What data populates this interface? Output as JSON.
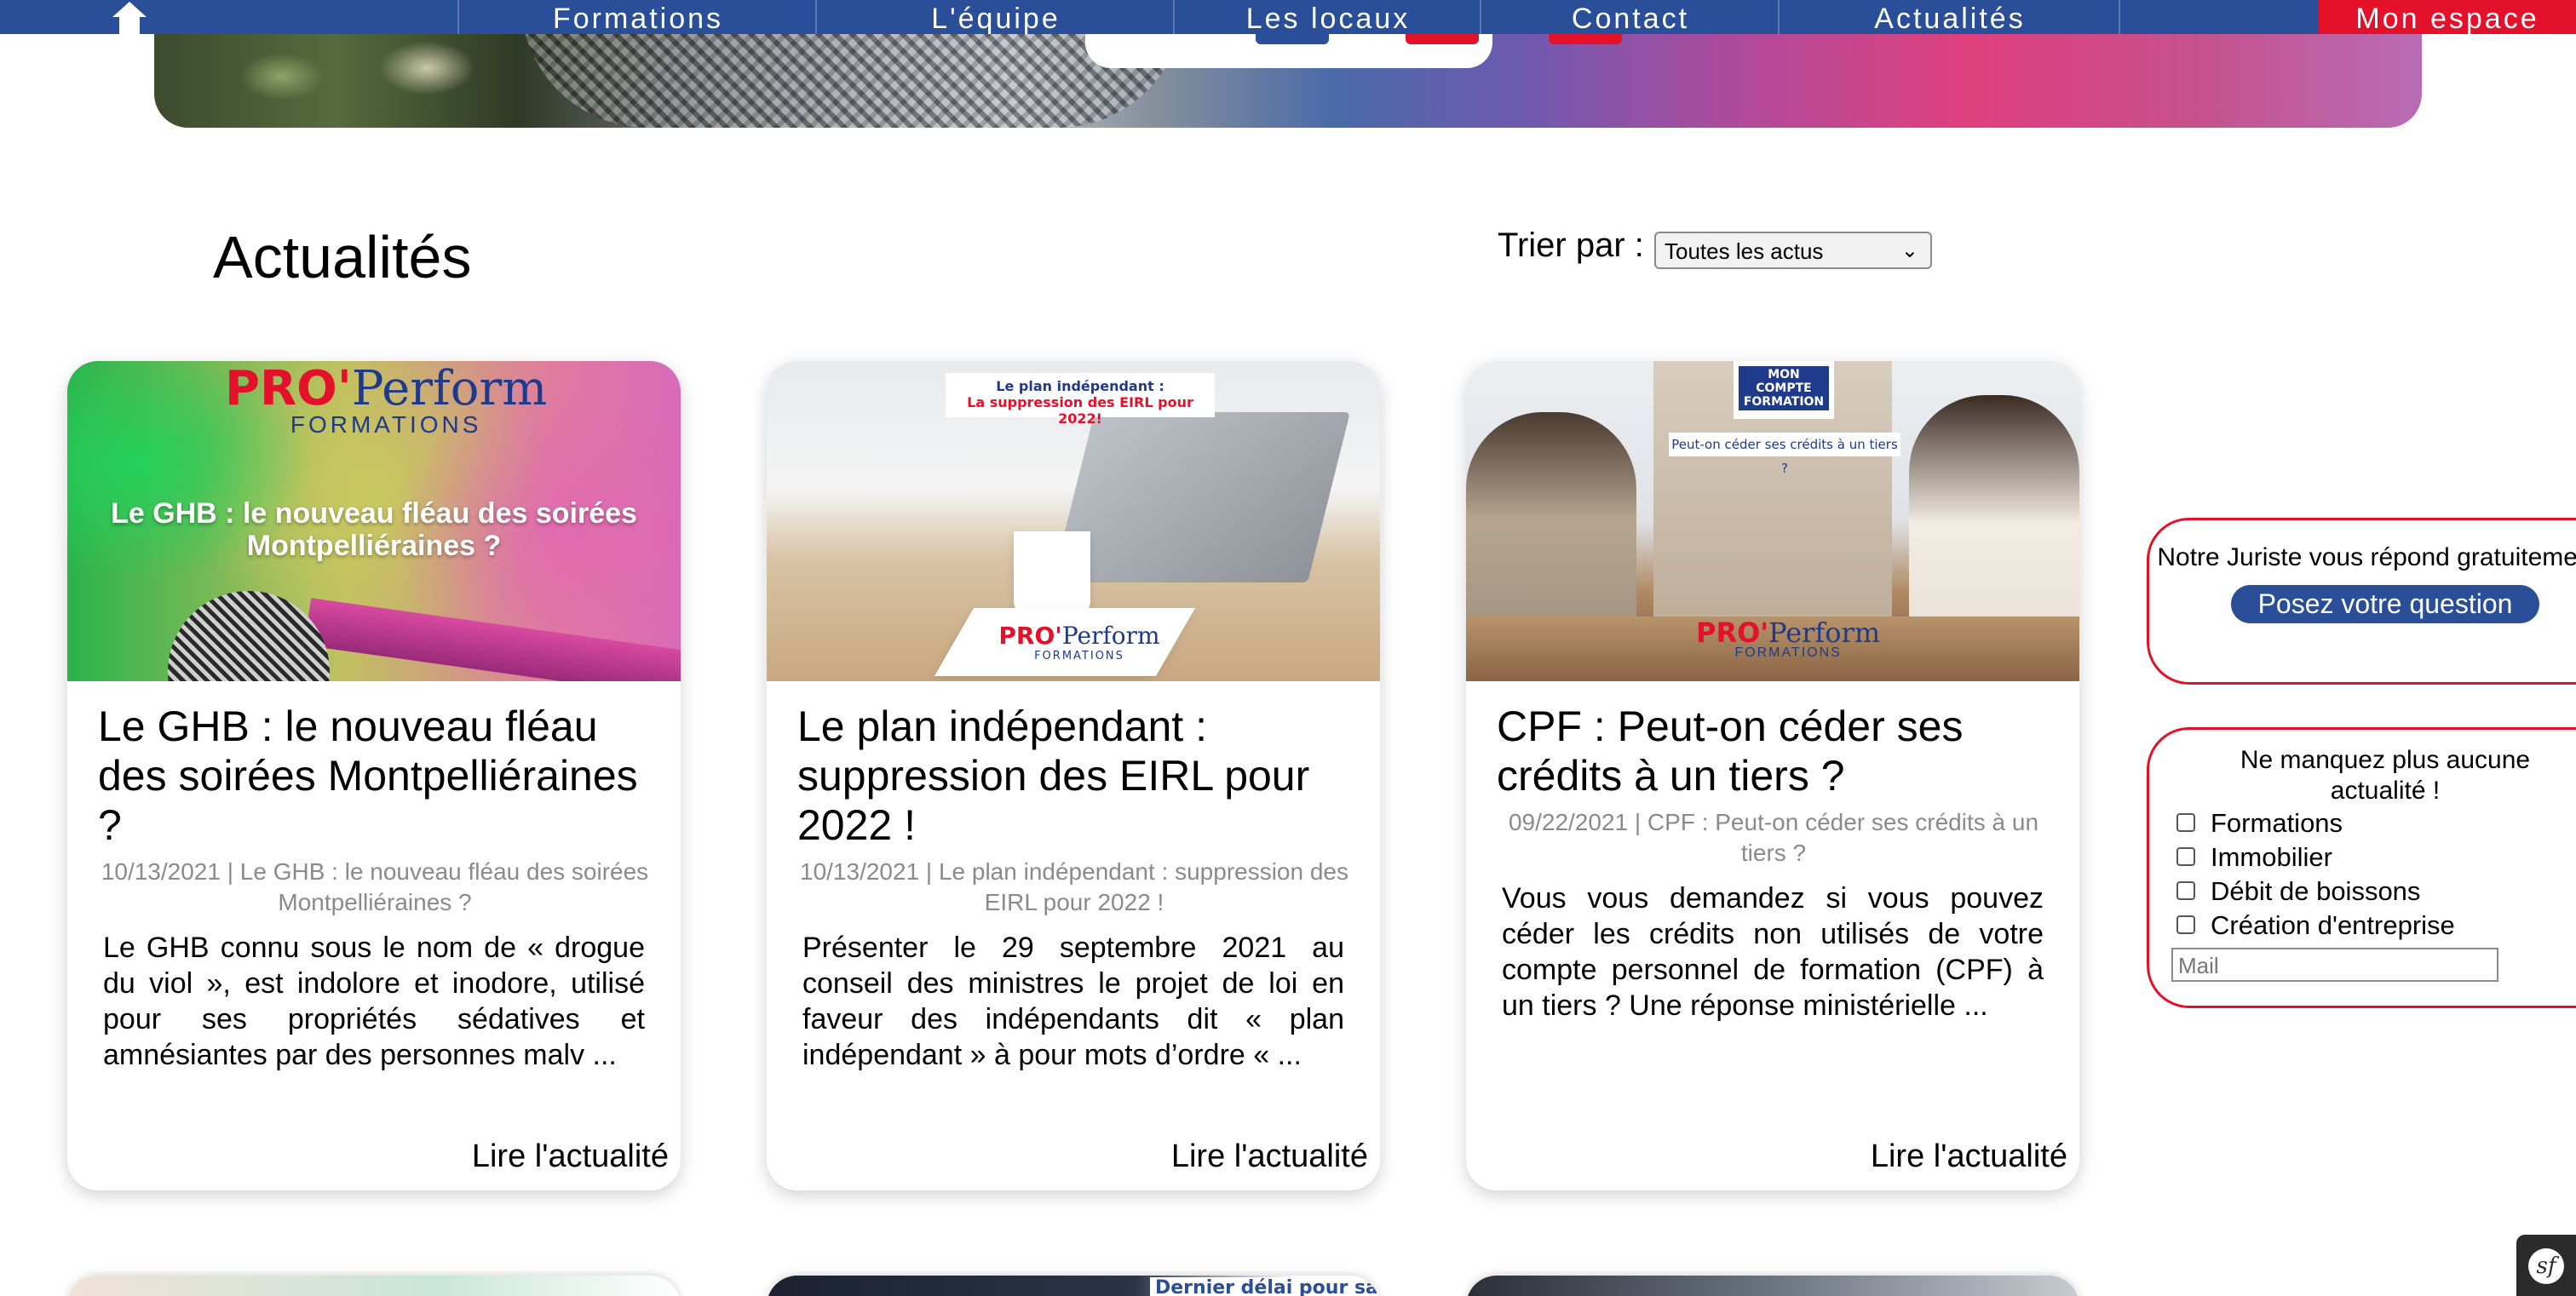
{
  "nav": {
    "items": [
      "Formations",
      "L'équipe",
      "Les locaux",
      "Contact",
      "Actualités"
    ],
    "espace": "Mon espace",
    "home_icon": "home-icon"
  },
  "page": {
    "title": "Actualités",
    "sort_label": "Trier par :",
    "sort_selected": "Toutes les actus"
  },
  "logo": {
    "pro": "PRO'",
    "perform": "Perform",
    "sub": "FORMATIONS"
  },
  "cards": [
    {
      "image_text": "Le GHB : le nouveau fléau des soirées Montpelliéraines ?",
      "title": "Le GHB : le nouveau fléau des soirées Montpelliéraines ?",
      "meta": "10/13/2021 | Le GHB : le nouveau fléau des soirées Montpelliéraines ?",
      "excerpt": "Le GHB connu sous le nom de « drogue du viol », est indolore et inodore, utilisé pour ses propriétés sédatives et amnésiantes par des personnes malv ...",
      "link": "Lire l'actualité"
    },
    {
      "image_banner_line1": "Le plan indépendant :",
      "image_banner_line2": "La suppression des EIRL pour 2022!",
      "title": "Le plan indépendant : suppression des EIRL pour 2022 !",
      "meta": "10/13/2021 | Le plan indépendant : suppression des EIRL pour 2022 !",
      "excerpt": "Présenter le 29 septembre 2021 au conseil des ministres le projet de loi en faveur des indépendants dit « plan indépendant » à pour mots d’ordre «  ...",
      "link": "Lire l'actualité"
    },
    {
      "image_badge_line1": "MON",
      "image_badge_line2": "COMPTE",
      "image_badge_line3": "FORMATION",
      "image_question": "Peut-on céder ses crédits à un tiers ?",
      "title": "CPF : Peut-on céder ses crédits à un tiers ?",
      "meta": "09/22/2021 | CPF : Peut-on céder ses crédits à un tiers ?",
      "excerpt": "Vous vous demandez si vous pouvez céder les crédits non utilisés de votre compte personnel de formation (CPF) à un tiers ? Une réponse ministérielle ...",
      "link": "Lire l'actualité"
    }
  ],
  "widget_juriste": {
    "title": "Notre Juriste vous répond gratuitement !",
    "button": "Posez votre question"
  },
  "widget_newsletter": {
    "title": "Ne manquez plus aucune actualité !",
    "options": [
      "Formations",
      "Immobilier",
      "Débit de boissons",
      "Création d'entreprise"
    ],
    "mail_placeholder": "Mail"
  },
  "bottom_row": {
    "partial_text": "Dernier délai pour saisi"
  },
  "debug_badge": "sf",
  "colors": {
    "nav_blue": "#2a4e97",
    "accent_red": "#e3122a"
  }
}
